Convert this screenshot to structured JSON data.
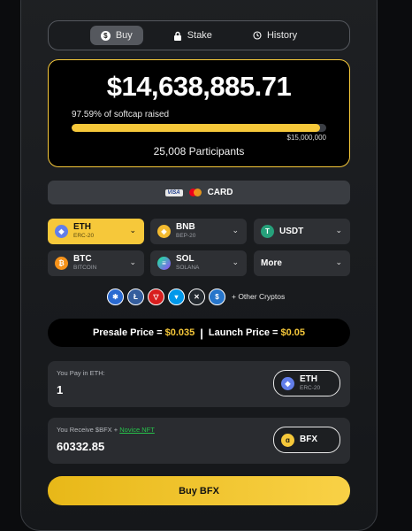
{
  "tabs": [
    {
      "label": "Buy",
      "icon": "dollar-icon",
      "active": true
    },
    {
      "label": "Stake",
      "icon": "lock-icon",
      "active": false
    },
    {
      "label": "History",
      "icon": "history-icon",
      "active": false
    }
  ],
  "presale": {
    "raised_amount": "$14,638,885.71",
    "softcap_text": "97.59% of softcap raised",
    "progress_percent": 97.59,
    "goal": "$15,000,000",
    "participants": "25,008 Participants"
  },
  "payment_card": {
    "visa_label": "VISA",
    "label": "CARD"
  },
  "coins": [
    {
      "symbol": "ETH",
      "network": "ERC-20",
      "icon": "ethereum-icon",
      "icon_glyph": "◆",
      "color": "#627eea",
      "selected": true
    },
    {
      "symbol": "BNB",
      "network": "BEP-20",
      "icon": "bnb-icon",
      "icon_glyph": "◈",
      "color": "#f3ba2f",
      "selected": false
    },
    {
      "symbol": "USDT",
      "network": "",
      "icon": "tether-icon",
      "icon_glyph": "T",
      "color": "#26a17b",
      "selected": false
    },
    {
      "symbol": "BTC",
      "network": "BITCOIN",
      "icon": "bitcoin-icon",
      "icon_glyph": "₿",
      "color": "#f7931a",
      "selected": false
    },
    {
      "symbol": "SOL",
      "network": "SOLANA",
      "icon": "solana-icon",
      "icon_glyph": "≡",
      "color": "#9945ff",
      "selected": false
    },
    {
      "symbol": "More",
      "network": "",
      "icon": "",
      "icon_glyph": "",
      "color": "",
      "selected": false
    }
  ],
  "other_cryptos": {
    "label": "+ Other Cryptos",
    "icons": [
      {
        "name": "cardano-icon",
        "glyph": "✱",
        "color": "#2a6ad1"
      },
      {
        "name": "litecoin-icon",
        "glyph": "Ł",
        "color": "#345d9d"
      },
      {
        "name": "tron-icon",
        "glyph": "▽",
        "color": "#d81e1e"
      },
      {
        "name": "toncoin-icon",
        "glyph": "▾",
        "color": "#0098ea"
      },
      {
        "name": "xrp-icon",
        "glyph": "✕",
        "color": "#23292f"
      },
      {
        "name": "usdc-icon",
        "glyph": "$",
        "color": "#2775ca"
      }
    ]
  },
  "prices": {
    "presale_label": "Presale Price =",
    "presale_value": "$0.035",
    "separator": "|",
    "launch_label": "Launch Price =",
    "launch_value": "$0.05"
  },
  "pay": {
    "label": "You Pay in ETH:",
    "value": "1",
    "token": "ETH",
    "network": "ERC-20"
  },
  "receive": {
    "label": "You Receive $BFX +",
    "nft_link": "Novice NFT",
    "value": "60332.85",
    "token": "BFX"
  },
  "buy_button": "Buy BFX",
  "colors": {
    "accent": "#f6c83a",
    "nft_link": "#27c24b"
  }
}
